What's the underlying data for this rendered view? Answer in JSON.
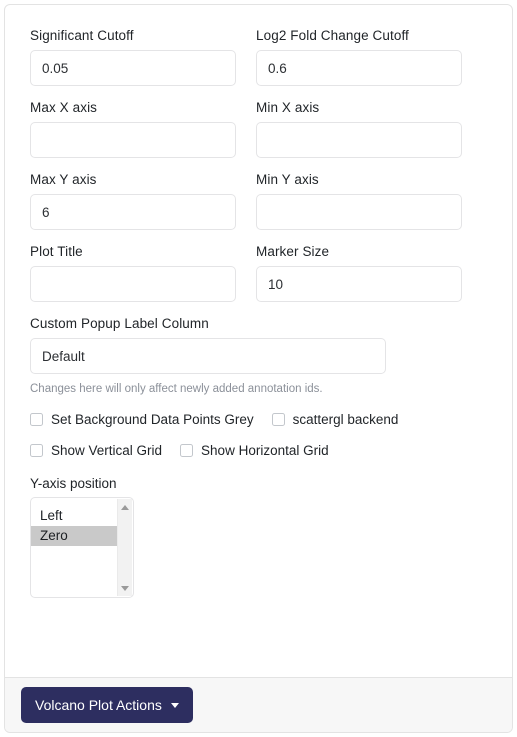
{
  "panel": {
    "fields": [
      {
        "name": "significant-cutoff",
        "label": "Significant Cutoff",
        "value": "0.05",
        "placeholder": ""
      },
      {
        "name": "log2-fold-change-cutoff",
        "label": "Log2 Fold Change Cutoff",
        "value": "0.6",
        "placeholder": ""
      },
      {
        "name": "max-x-axis",
        "label": "Max X axis",
        "value": "",
        "placeholder": ""
      },
      {
        "name": "min-x-axis",
        "label": "Min X axis",
        "value": "",
        "placeholder": ""
      },
      {
        "name": "max-y-axis",
        "label": "Max Y axis",
        "value": "6",
        "placeholder": ""
      },
      {
        "name": "min-y-axis",
        "label": "Min Y axis",
        "value": "",
        "placeholder": ""
      },
      {
        "name": "plot-title",
        "label": "Plot Title",
        "value": "",
        "placeholder": ""
      },
      {
        "name": "marker-size",
        "label": "Marker Size",
        "value": "10",
        "placeholder": ""
      }
    ],
    "custom_popup": {
      "label": "Custom Popup Label Column",
      "value": "Default",
      "placeholder": "",
      "help": "Changes here will only affect newly added annotation ids."
    },
    "checkboxes": [
      {
        "name": "set-background-data-points-grey",
        "label": "Set Background Data Points Grey",
        "checked": false
      },
      {
        "name": "scattergl-backend",
        "label": "scattergl backend",
        "checked": false
      },
      {
        "name": "show-vertical-grid",
        "label": "Show Vertical Grid",
        "checked": false
      },
      {
        "name": "show-horizontal-grid",
        "label": "Show Horizontal Grid",
        "checked": false
      }
    ],
    "y_axis_position": {
      "label": "Y-axis position",
      "options": [
        "Left",
        "Zero"
      ],
      "selected": "Zero"
    },
    "footer": {
      "action_label": "Volcano Plot Actions",
      "caret_icon": "caret-down-icon",
      "button_color": "#2d2e60"
    }
  }
}
